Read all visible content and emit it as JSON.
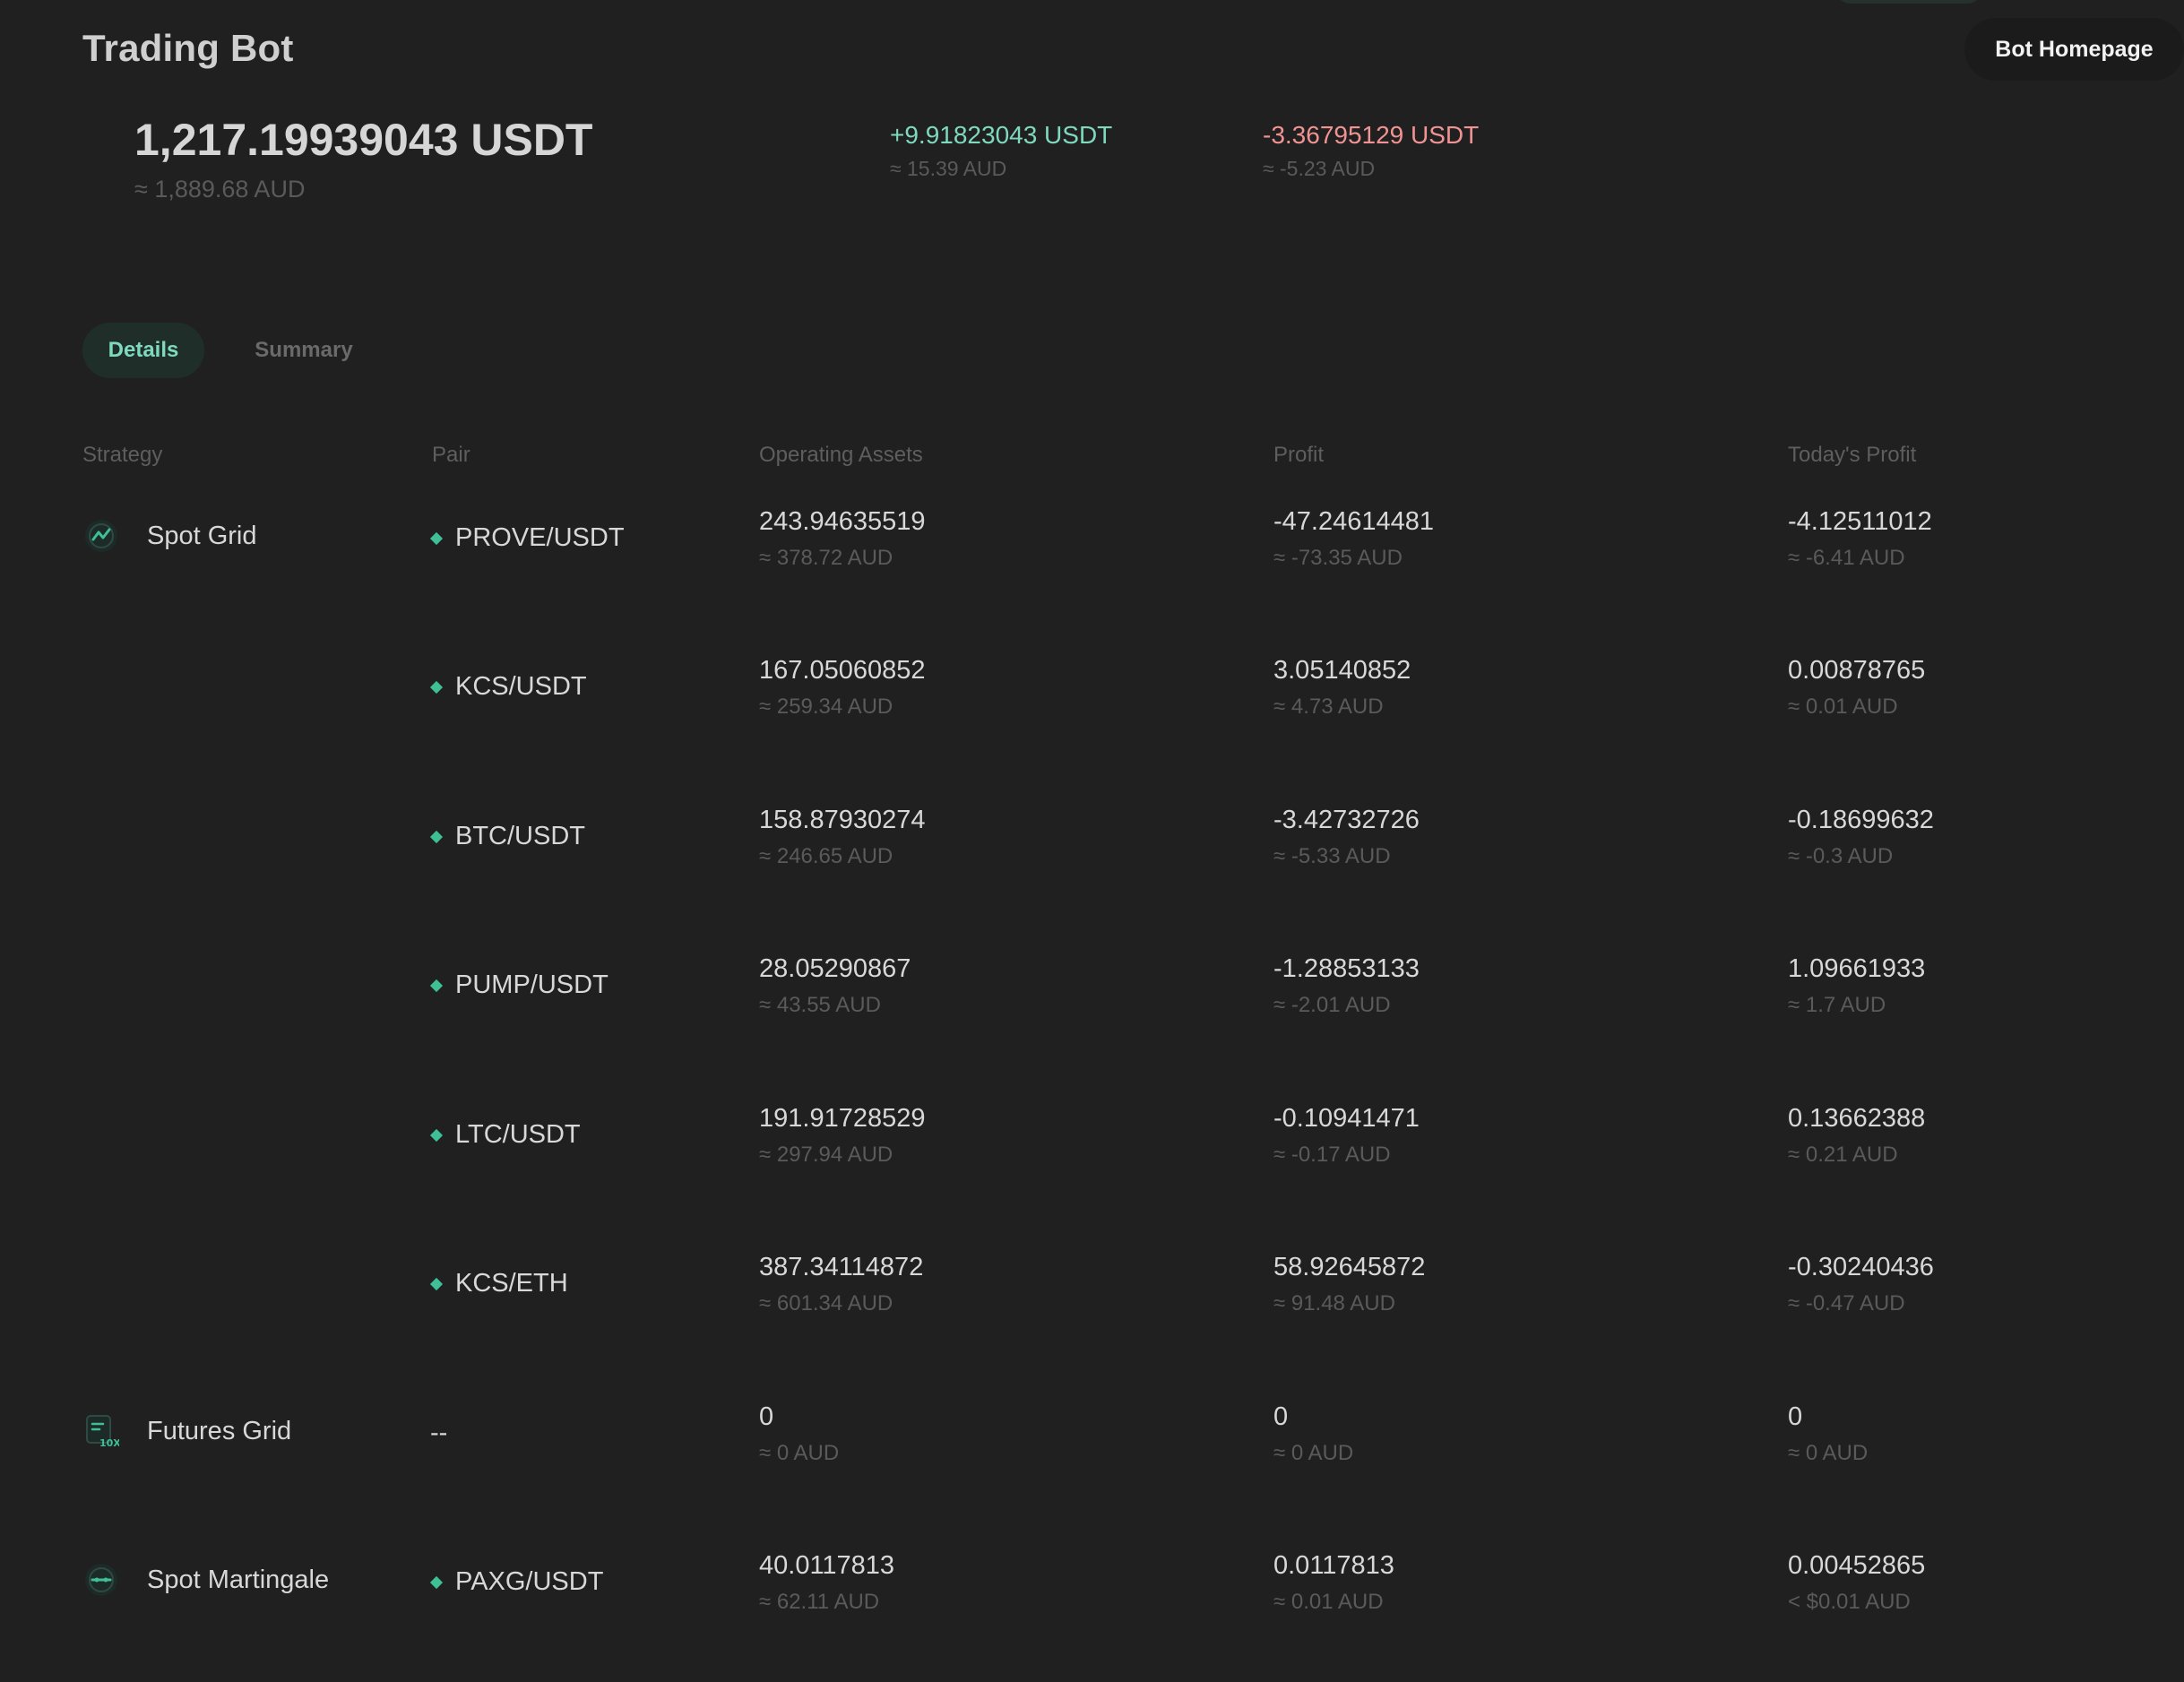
{
  "header": {
    "title": "Trading Bot",
    "home_button": "Bot Homepage"
  },
  "summary": {
    "total": "1,217.19939043 USDT",
    "total_fiat": "≈ 1,889.68 AUD",
    "stat1_value": "+9.91823043 USDT",
    "stat1_fiat": "≈ 15.39 AUD",
    "stat2_value": "-3.36795129 USDT",
    "stat2_fiat": "≈ -5.23 AUD"
  },
  "tabs": [
    {
      "label": "Details",
      "active": true
    },
    {
      "label": "Summary",
      "active": false
    }
  ],
  "table": {
    "headers": [
      "Strategy",
      "Pair",
      "Operating Assets",
      "Profit",
      "Today's Profit"
    ],
    "rows": [
      {
        "strategy": "Spot Grid",
        "icon": "spot-grid-icon",
        "pair": "PROVE/USDT",
        "assets": "243.94635519",
        "assets_fiat": "≈ 378.72 AUD",
        "profit": "-47.24614481",
        "profit_fiat": "≈ -73.35 AUD",
        "today": "-4.12511012",
        "today_fiat": "≈ -6.41 AUD"
      },
      {
        "strategy": "",
        "icon": "",
        "pair": "KCS/USDT",
        "assets": "167.05060852",
        "assets_fiat": "≈ 259.34 AUD",
        "profit": "3.05140852",
        "profit_fiat": "≈ 4.73 AUD",
        "today": "0.00878765",
        "today_fiat": "≈ 0.01 AUD"
      },
      {
        "strategy": "",
        "icon": "",
        "pair": "BTC/USDT",
        "assets": "158.87930274",
        "assets_fiat": "≈ 246.65 AUD",
        "profit": "-3.42732726",
        "profit_fiat": "≈ -5.33 AUD",
        "today": "-0.18699632",
        "today_fiat": "≈ -0.3 AUD"
      },
      {
        "strategy": "",
        "icon": "",
        "pair": "PUMP/USDT",
        "assets": "28.05290867",
        "assets_fiat": "≈ 43.55 AUD",
        "profit": "-1.28853133",
        "profit_fiat": "≈ -2.01 AUD",
        "today": "1.09661933",
        "today_fiat": "≈ 1.7 AUD"
      },
      {
        "strategy": "",
        "icon": "",
        "pair": "LTC/USDT",
        "assets": "191.91728529",
        "assets_fiat": "≈ 297.94 AUD",
        "profit": "-0.10941471",
        "profit_fiat": "≈ -0.17 AUD",
        "today": "0.13662388",
        "today_fiat": "≈ 0.21 AUD"
      },
      {
        "strategy": "",
        "icon": "",
        "pair": "KCS/ETH",
        "assets": "387.34114872",
        "assets_fiat": "≈ 601.34 AUD",
        "profit": "58.92645872",
        "profit_fiat": "≈ 91.48 AUD",
        "today": "-0.30240436",
        "today_fiat": "≈ -0.47 AUD"
      },
      {
        "strategy": "Futures Grid",
        "icon": "futures-grid-icon",
        "pair": "--",
        "assets": "0",
        "assets_fiat": "≈ 0 AUD",
        "profit": "0",
        "profit_fiat": "≈ 0 AUD",
        "today": "0",
        "today_fiat": "≈ 0 AUD"
      },
      {
        "strategy": "Spot Martingale",
        "icon": "spot-martingale-icon",
        "pair": "PAXG/USDT",
        "assets": "40.0117813",
        "assets_fiat": "≈ 62.11 AUD",
        "profit": "0.0117813",
        "profit_fiat": "≈ 0.01 AUD",
        "today": "0.00452865",
        "today_fiat": "< $0.01 AUD"
      }
    ]
  },
  "colors": {
    "positive": "#7fd9bd",
    "negative": "#f19393",
    "accent": "#3fbf95",
    "background": "#202020"
  }
}
